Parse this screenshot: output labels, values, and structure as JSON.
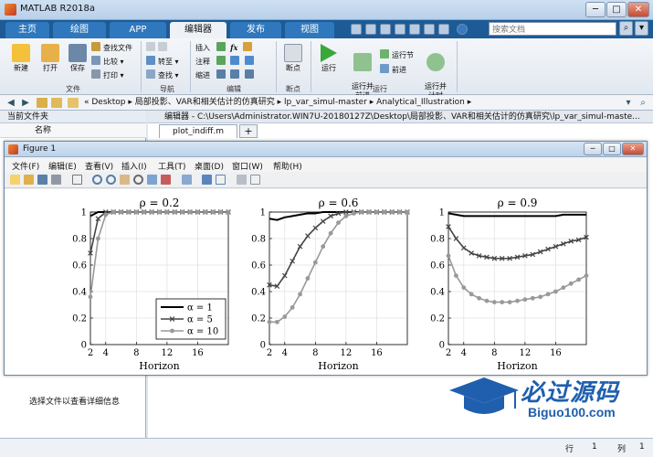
{
  "app": {
    "title": "MATLAB R2018a",
    "window_controls": [
      "─",
      "□",
      "✕"
    ]
  },
  "tabs": [
    {
      "label": "主页",
      "active": false
    },
    {
      "label": "绘图",
      "active": false
    },
    {
      "label": "APP",
      "active": false
    },
    {
      "label": "编辑器",
      "active": true
    },
    {
      "label": "发布",
      "active": false
    },
    {
      "label": "视图",
      "active": false
    }
  ],
  "search": {
    "placeholder": "搜索文档"
  },
  "ribbon": {
    "file_group": {
      "label": "文件",
      "new": "新建",
      "open": "打开",
      "save": "保存",
      "find_files": "查找文件",
      "compare": "比较",
      "print": "打印"
    },
    "navigate_group": {
      "label": "导航",
      "goto": "转至",
      "find": "查找"
    },
    "edit_group": {
      "label": "编辑",
      "insert": "插入",
      "comment": "注释",
      "indent": "缩进",
      "fx": "fx"
    },
    "breakpoint_group": {
      "label": "断点",
      "breakpoints": "断点"
    },
    "run_group": {
      "label": "运行",
      "run": "运行",
      "run_advance": "运行并\n前进",
      "run_section": "运行节",
      "advance": "前进",
      "run_time": "运行并\n计时"
    }
  },
  "pathbar": {
    "segments": [
      "Desktop",
      "局部投影、VAR和相关估计的仿真研究",
      "lp_var_simul-master",
      "Analytical_Illustration"
    ]
  },
  "left_panel": {
    "title": "当前文件夹",
    "column": "名称",
    "detail_hint": "选择文件以查看详细信息"
  },
  "editor": {
    "header": "编辑器 - C:\\Users\\Administrator.WIN7U-20180127Z\\Desktop\\局部投影、VAR和相关估计的仿真研究\\lp_var_simul-maste...",
    "tab": "plot_indiff.m"
  },
  "status": {
    "row_label": "行",
    "row": "1",
    "col_label": "列",
    "col": "1"
  },
  "figure": {
    "title": "Figure 1",
    "menu": [
      "文件(F)",
      "编辑(E)",
      "查看(V)",
      "插入(I)",
      "工具(T)",
      "桌面(D)",
      "窗口(W)",
      "帮助(H)"
    ]
  },
  "watermark": {
    "brand": "必过源码",
    "site": "Biguo100.com"
  },
  "chart_data": [
    {
      "type": "line",
      "title": "ρ = 0.2",
      "xlabel": "Horizon",
      "ylabel": "",
      "xlim": [
        2,
        20
      ],
      "ylim": [
        0,
        1
      ],
      "xticks": [
        2,
        4,
        8,
        12,
        16
      ],
      "yticks": [
        0,
        0.2,
        0.4,
        0.6,
        0.8,
        1
      ],
      "x": [
        2,
        3,
        4,
        5,
        6,
        7,
        8,
        9,
        10,
        11,
        12,
        13,
        14,
        15,
        16,
        17,
        18,
        19,
        20
      ],
      "legend": "bottom-right",
      "series": [
        {
          "name": "α = 1",
          "color": "#000000",
          "marker": "none",
          "values": [
            0.97,
            1,
            1,
            1,
            1,
            1,
            1,
            1,
            1,
            1,
            1,
            1,
            1,
            1,
            1,
            1,
            1,
            1,
            1
          ]
        },
        {
          "name": "α = 5",
          "color": "#444444",
          "marker": "x",
          "values": [
            0.69,
            0.95,
            1,
            1,
            1,
            1,
            1,
            1,
            1,
            1,
            1,
            1,
            1,
            1,
            1,
            1,
            1,
            1,
            1
          ]
        },
        {
          "name": "α = 10",
          "color": "#999999",
          "marker": "o",
          "values": [
            0.36,
            0.8,
            0.98,
            1,
            1,
            1,
            1,
            1,
            1,
            1,
            1,
            1,
            1,
            1,
            1,
            1,
            1,
            1,
            1
          ]
        }
      ]
    },
    {
      "type": "line",
      "title": "ρ = 0.6",
      "xlabel": "Horizon",
      "ylabel": "",
      "xlim": [
        2,
        20
      ],
      "ylim": [
        0,
        1
      ],
      "xticks": [
        2,
        4,
        8,
        12,
        16
      ],
      "yticks": [
        0,
        0.2,
        0.4,
        0.6,
        0.8,
        1
      ],
      "x": [
        2,
        3,
        4,
        5,
        6,
        7,
        8,
        9,
        10,
        11,
        12,
        13,
        14,
        15,
        16,
        17,
        18,
        19,
        20
      ],
      "series": [
        {
          "name": "α = 1",
          "color": "#000000",
          "marker": "none",
          "values": [
            0.95,
            0.94,
            0.96,
            0.97,
            0.98,
            0.99,
            0.99,
            1,
            1,
            1,
            1,
            1,
            1,
            1,
            1,
            1,
            1,
            1,
            1
          ]
        },
        {
          "name": "α = 5",
          "color": "#444444",
          "marker": "x",
          "values": [
            0.45,
            0.44,
            0.52,
            0.63,
            0.74,
            0.82,
            0.88,
            0.93,
            0.97,
            0.99,
            1,
            1,
            1,
            1,
            1,
            1,
            1,
            1,
            1
          ]
        },
        {
          "name": "α = 10",
          "color": "#999999",
          "marker": "o",
          "values": [
            0.17,
            0.17,
            0.21,
            0.28,
            0.38,
            0.5,
            0.62,
            0.74,
            0.84,
            0.92,
            0.97,
            0.99,
            1,
            1,
            1,
            1,
            1,
            1,
            1
          ]
        }
      ]
    },
    {
      "type": "line",
      "title": "ρ = 0.9",
      "xlabel": "Horizon",
      "ylabel": "",
      "xlim": [
        2,
        20
      ],
      "ylim": [
        0,
        1
      ],
      "xticks": [
        2,
        4,
        8,
        12,
        16
      ],
      "yticks": [
        0,
        0.2,
        0.4,
        0.6,
        0.8,
        1
      ],
      "x": [
        2,
        3,
        4,
        5,
        6,
        7,
        8,
        9,
        10,
        11,
        12,
        13,
        14,
        15,
        16,
        17,
        18,
        19,
        20
      ],
      "series": [
        {
          "name": "α = 1",
          "color": "#000000",
          "marker": "none",
          "values": [
            0.99,
            0.98,
            0.97,
            0.97,
            0.97,
            0.97,
            0.97,
            0.97,
            0.97,
            0.97,
            0.97,
            0.97,
            0.97,
            0.97,
            0.97,
            0.98,
            0.98,
            0.98,
            0.98
          ]
        },
        {
          "name": "α = 5",
          "color": "#444444",
          "marker": "x",
          "values": [
            0.89,
            0.8,
            0.73,
            0.69,
            0.67,
            0.66,
            0.65,
            0.65,
            0.65,
            0.66,
            0.67,
            0.68,
            0.7,
            0.72,
            0.74,
            0.76,
            0.78,
            0.79,
            0.81
          ]
        },
        {
          "name": "α = 10",
          "color": "#999999",
          "marker": "o",
          "values": [
            0.67,
            0.52,
            0.43,
            0.38,
            0.35,
            0.33,
            0.32,
            0.32,
            0.32,
            0.33,
            0.34,
            0.35,
            0.36,
            0.38,
            0.4,
            0.43,
            0.46,
            0.49,
            0.52
          ]
        }
      ]
    }
  ]
}
